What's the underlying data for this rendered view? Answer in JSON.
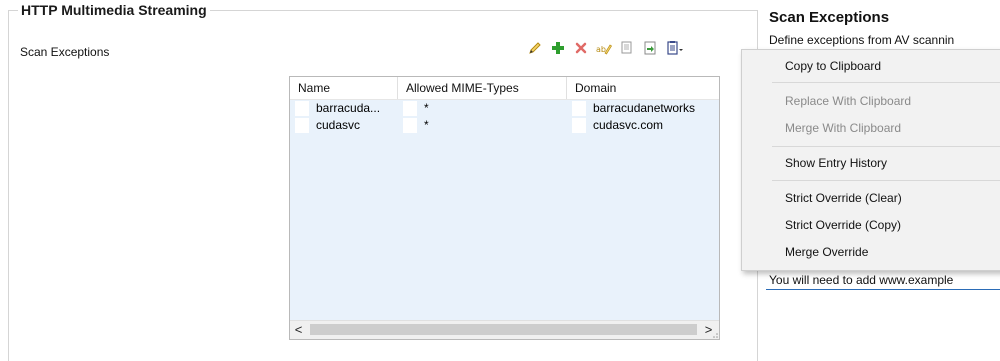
{
  "group": {
    "title": "HTTP Multimedia Streaming",
    "field_label": "Scan Exceptions"
  },
  "toolbar": {
    "buttons": [
      {
        "icon": "pencil-edit-icon",
        "color": "#d4a017"
      },
      {
        "icon": "plus-add-icon",
        "color": "#2e9e2e"
      },
      {
        "icon": "x-delete-icon",
        "color": "#d9534f"
      },
      {
        "icon": "rename-icon",
        "color": "#c9a227"
      },
      {
        "icon": "copy-icon",
        "color": "#7a7a7a"
      },
      {
        "icon": "paste-icon",
        "color": "#3a8a3a"
      },
      {
        "icon": "clipboard-menu-icon",
        "color": "#3a4a8a"
      }
    ]
  },
  "table": {
    "columns": [
      "Name",
      "Allowed MIME-Types",
      "Domain"
    ],
    "rows": [
      {
        "name": "barracuda...",
        "mime": "*",
        "domain": "barracudanetworks"
      },
      {
        "name": "cudasvc",
        "mime": "*",
        "domain": "cudasvc.com"
      }
    ],
    "scroll_left": "<",
    "scroll_right": ">"
  },
  "side": {
    "title": "Scan Exceptions",
    "description": "Define exceptions from AV scannin",
    "note": "You will need to add www.example"
  },
  "menu": {
    "items": [
      {
        "label": "Copy to Clipboard",
        "enabled": true
      },
      {
        "label": "Replace With Clipboard",
        "enabled": false
      },
      {
        "label": "Merge With Clipboard",
        "enabled": false
      },
      {
        "label": "Show Entry History",
        "enabled": true
      },
      {
        "label": "Strict Override (Clear)",
        "enabled": true
      },
      {
        "label": "Strict Override (Copy)",
        "enabled": true
      },
      {
        "label": "Merge Override",
        "enabled": true
      }
    ]
  },
  "colors": {
    "table_bg": "#e9f2fb",
    "menu_bg": "#f2f2f2",
    "accent_line": "#2b6cb7"
  }
}
